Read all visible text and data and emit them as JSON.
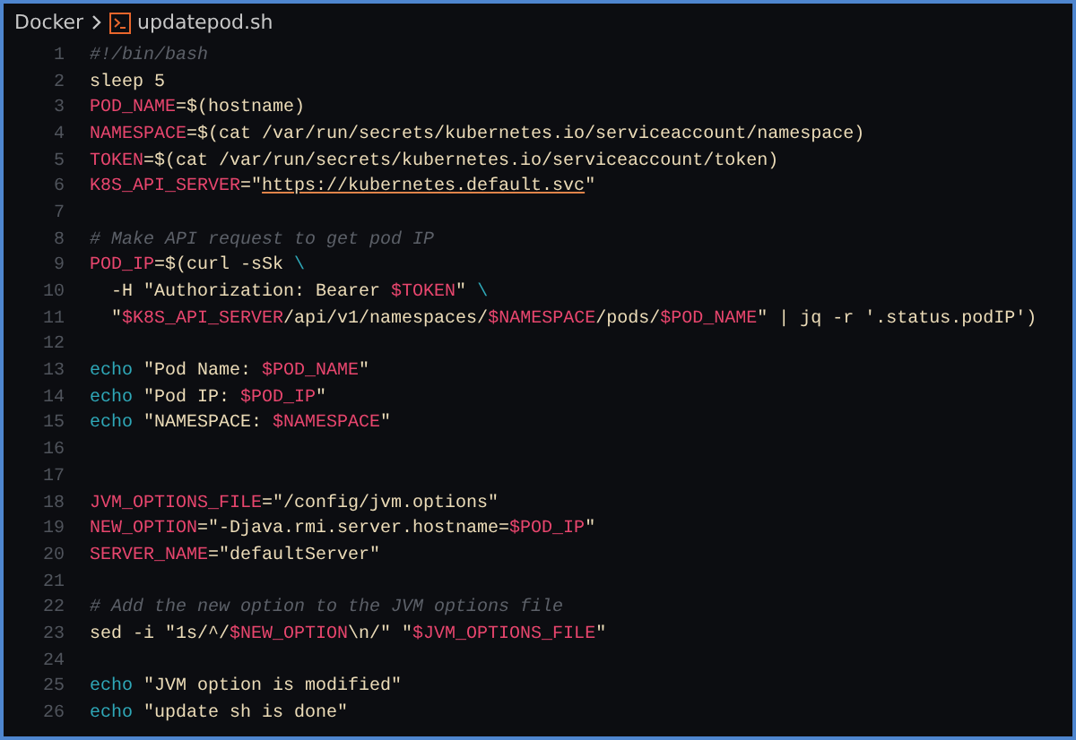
{
  "breadcrumb": {
    "folder": "Docker",
    "file": "updatepod.sh"
  },
  "lines": [
    {
      "number": "1",
      "tokens": [
        {
          "t": "#!/bin/bash",
          "kind": "comment"
        }
      ]
    },
    {
      "number": "2",
      "tokens": [
        {
          "t": "sleep 5",
          "kind": "text"
        }
      ]
    },
    {
      "number": "3",
      "tokens": [
        {
          "t": "POD_NAME",
          "kind": "var"
        },
        {
          "t": "=$(hostname)",
          "kind": "text"
        }
      ]
    },
    {
      "number": "4",
      "tokens": [
        {
          "t": "NAMESPACE",
          "kind": "var"
        },
        {
          "t": "=$(cat /var/run/secrets/kubernetes.io/serviceaccount/namespace)",
          "kind": "text"
        }
      ]
    },
    {
      "number": "5",
      "tokens": [
        {
          "t": "TOKEN",
          "kind": "var"
        },
        {
          "t": "=$(cat /var/run/secrets/kubernetes.io/serviceaccount/token)",
          "kind": "text"
        }
      ]
    },
    {
      "number": "6",
      "tokens": [
        {
          "t": "K8S_API_SERVER",
          "kind": "var"
        },
        {
          "t": "=\"",
          "kind": "text"
        },
        {
          "t": "https://kubernetes.default.svc",
          "kind": "url"
        },
        {
          "t": "\"",
          "kind": "text"
        }
      ]
    },
    {
      "number": "7"
    },
    {
      "number": "8",
      "tokens": [
        {
          "t": "# Make API request to get pod IP",
          "kind": "comment"
        }
      ]
    },
    {
      "number": "9",
      "tokens": [
        {
          "t": "POD_IP",
          "kind": "var"
        },
        {
          "t": "=$(curl -sSk ",
          "kind": "text"
        },
        {
          "t": "\\",
          "kind": "builtin"
        }
      ]
    },
    {
      "number": "10",
      "tokens": [
        {
          "t": "  -H \"Authorization: Bearer ",
          "kind": "text"
        },
        {
          "t": "$TOKEN",
          "kind": "var"
        },
        {
          "t": "\" ",
          "kind": "text"
        },
        {
          "t": "\\",
          "kind": "builtin"
        }
      ]
    },
    {
      "number": "11",
      "tokens": [
        {
          "t": "  \"",
          "kind": "text"
        },
        {
          "t": "$K8S_API_SERVER",
          "kind": "var"
        },
        {
          "t": "/api/v1/namespaces/",
          "kind": "text"
        },
        {
          "t": "$NAMESPACE",
          "kind": "var"
        },
        {
          "t": "/pods/",
          "kind": "text"
        },
        {
          "t": "$POD_NAME",
          "kind": "var"
        },
        {
          "t": "\" | jq -r '.status.podIP')",
          "kind": "text"
        }
      ]
    },
    {
      "number": "12"
    },
    {
      "number": "13",
      "tokens": [
        {
          "t": "echo",
          "kind": "builtin"
        },
        {
          "t": " \"Pod Name: ",
          "kind": "text"
        },
        {
          "t": "$POD_NAME",
          "kind": "var"
        },
        {
          "t": "\"",
          "kind": "text"
        }
      ]
    },
    {
      "number": "14",
      "tokens": [
        {
          "t": "echo",
          "kind": "builtin"
        },
        {
          "t": " \"Pod IP: ",
          "kind": "text"
        },
        {
          "t": "$POD_IP",
          "kind": "var"
        },
        {
          "t": "\"",
          "kind": "text"
        }
      ]
    },
    {
      "number": "15",
      "tokens": [
        {
          "t": "echo",
          "kind": "builtin"
        },
        {
          "t": " \"NAMESPACE: ",
          "kind": "text"
        },
        {
          "t": "$NAMESPACE",
          "kind": "var"
        },
        {
          "t": "\"",
          "kind": "text"
        }
      ]
    },
    {
      "number": "16"
    },
    {
      "number": "17"
    },
    {
      "number": "18",
      "tokens": [
        {
          "t": "JVM_OPTIONS_FILE",
          "kind": "var"
        },
        {
          "t": "=\"/config/jvm.options\"",
          "kind": "text"
        }
      ]
    },
    {
      "number": "19",
      "tokens": [
        {
          "t": "NEW_OPTION",
          "kind": "var"
        },
        {
          "t": "=\"-Djava.rmi.server.hostname=",
          "kind": "text"
        },
        {
          "t": "$POD_IP",
          "kind": "var"
        },
        {
          "t": "\"",
          "kind": "text"
        }
      ]
    },
    {
      "number": "20",
      "tokens": [
        {
          "t": "SERVER_NAME",
          "kind": "var"
        },
        {
          "t": "=\"defaultServer\"",
          "kind": "text"
        }
      ]
    },
    {
      "number": "21"
    },
    {
      "number": "22",
      "tokens": [
        {
          "t": "# Add the new option to the JVM options file",
          "kind": "comment"
        }
      ]
    },
    {
      "number": "23",
      "tokens": [
        {
          "t": "sed -i \"1s/^/",
          "kind": "text"
        },
        {
          "t": "$NEW_OPTION",
          "kind": "var"
        },
        {
          "t": "\\n/\" \"",
          "kind": "text"
        },
        {
          "t": "$JVM_OPTIONS_FILE",
          "kind": "var"
        },
        {
          "t": "\"",
          "kind": "text"
        }
      ]
    },
    {
      "number": "24"
    },
    {
      "number": "25",
      "tokens": [
        {
          "t": "echo",
          "kind": "builtin"
        },
        {
          "t": " \"JVM option is modified\"",
          "kind": "text"
        }
      ]
    },
    {
      "number": "26",
      "tokens": [
        {
          "t": "echo",
          "kind": "builtin"
        },
        {
          "t": " \"update sh is done\"",
          "kind": "text"
        }
      ]
    }
  ]
}
